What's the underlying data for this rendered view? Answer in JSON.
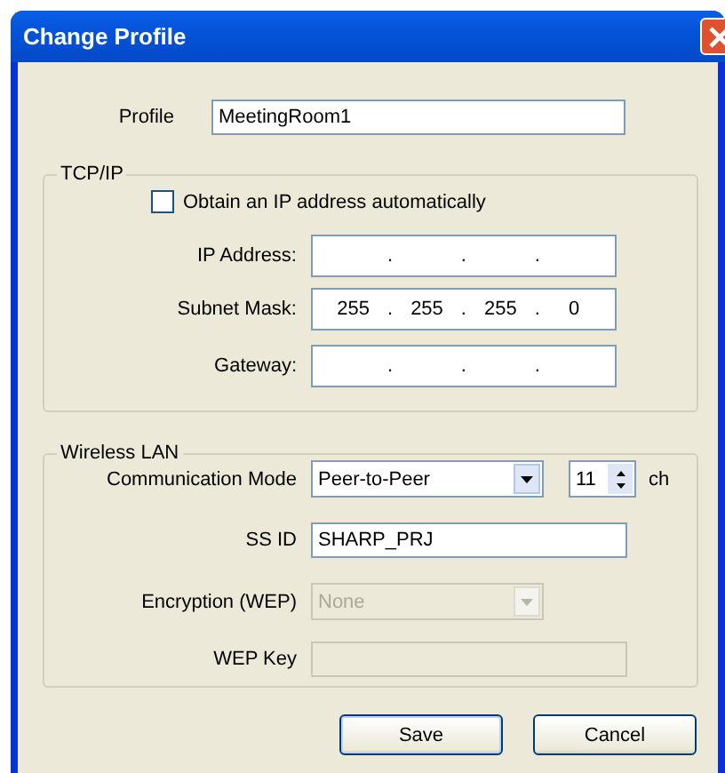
{
  "window": {
    "title": "Change Profile"
  },
  "profile": {
    "label": "Profile",
    "value": "MeetingRoom1"
  },
  "tcpip": {
    "legend": "TCP/IP",
    "auto_ip": {
      "label": "Obtain an IP address automatically",
      "checked": false
    },
    "fields": [
      {
        "label": "IP Address:",
        "separators": [
          ".",
          ".",
          "."
        ]
      },
      {
        "label": "Subnet Mask:",
        "octets": [
          "255",
          "255",
          "255",
          "0"
        ],
        "separators": [
          ".",
          ".",
          "."
        ]
      },
      {
        "label": "Gateway:",
        "separators": [
          ".",
          ".",
          "."
        ]
      }
    ]
  },
  "wireless": {
    "legend": "Wireless LAN",
    "mode": {
      "label": "Communication Mode",
      "value": "Peer-to-Peer",
      "channel": "11",
      "unit": "ch"
    },
    "ssid": {
      "label": "SS ID",
      "value": "SHARP_PRJ"
    },
    "encryption": {
      "label": "Encryption (WEP)",
      "value": "None",
      "disabled": true
    },
    "wep_key": {
      "label": "WEP Key",
      "disabled": true
    }
  },
  "buttons": [
    "Save",
    "Cancel"
  ]
}
